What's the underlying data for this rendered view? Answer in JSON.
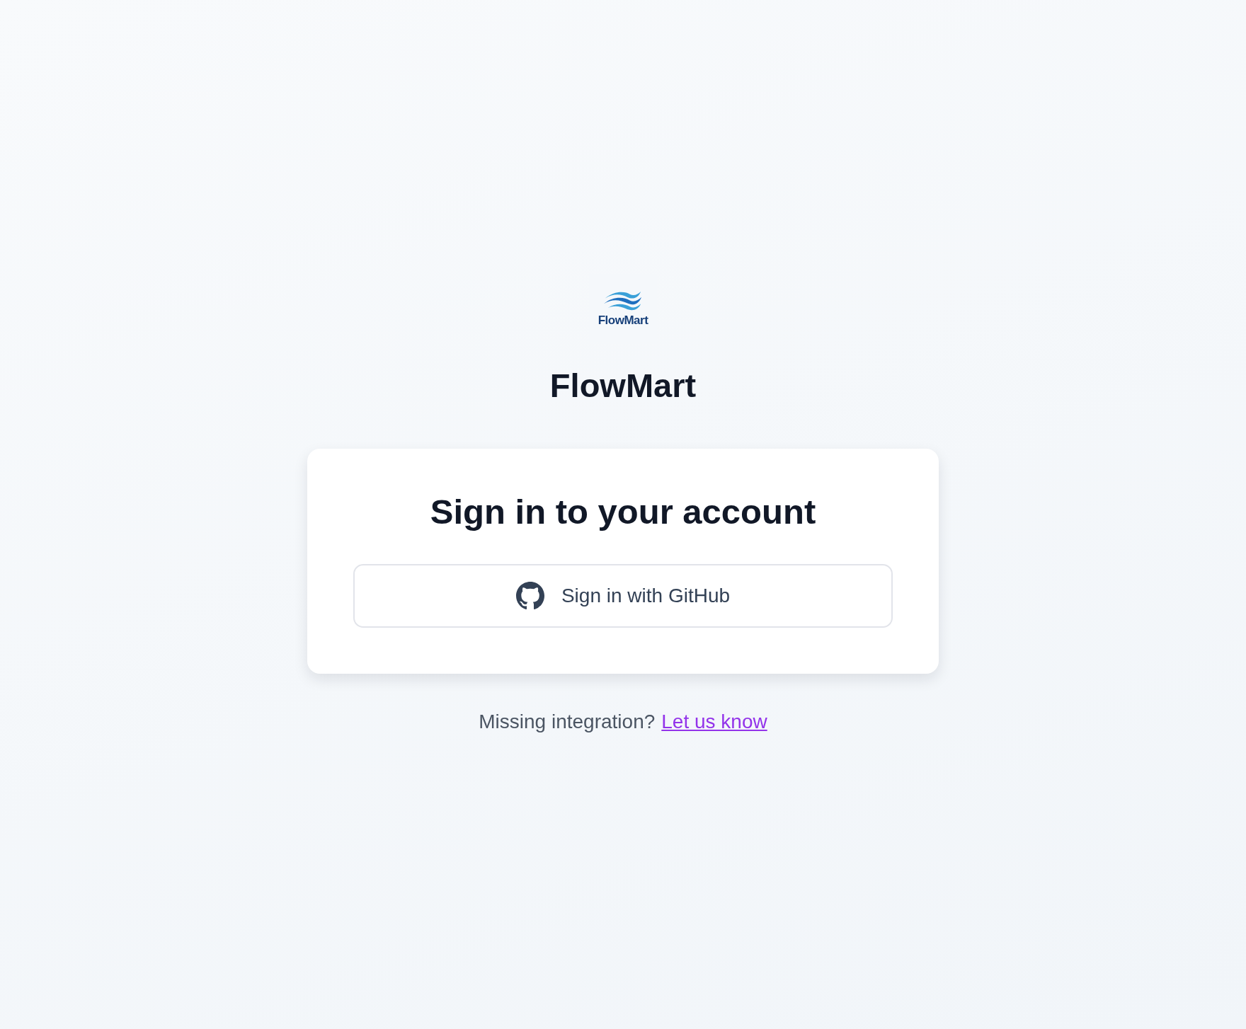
{
  "logo": {
    "wordmark": "FlowMart"
  },
  "app_name": "FlowMart",
  "card": {
    "heading": "Sign in to your account",
    "button": "Sign in with GitHub"
  },
  "footer": {
    "text": "Missing integration?",
    "link": "Let us know"
  }
}
